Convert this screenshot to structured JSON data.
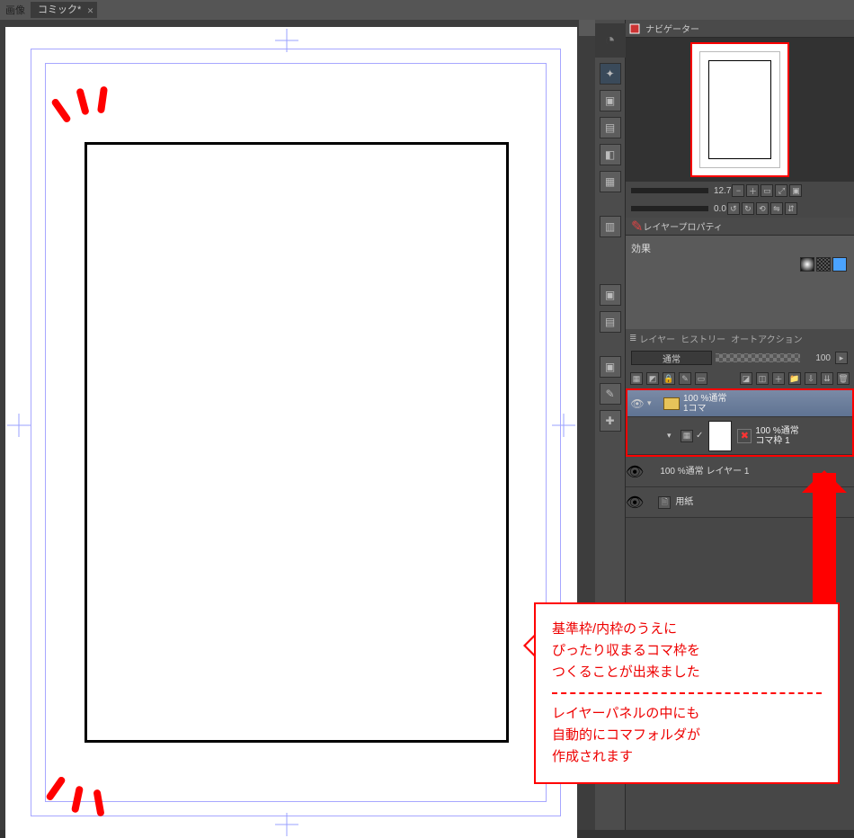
{
  "topbar": {
    "menu_label": "画像",
    "tab_title": "コミック*"
  },
  "navigator": {
    "title": "ナビゲーター",
    "zoom_value": "12.7",
    "rotate_value": "0.0"
  },
  "layer_property": {
    "title": "レイヤープロパティ",
    "section_label": "効果"
  },
  "layer_panel": {
    "tabs": {
      "layer": "レイヤー",
      "history": "ヒストリー",
      "auto_action": "オートアクション"
    },
    "blend_mode": "通常",
    "opacity": "100",
    "rows": {
      "folder": {
        "blend": "100 %通常",
        "name": "1コマ"
      },
      "frame": {
        "blend": "100 %通常",
        "name": "コマ枠 1"
      },
      "layer1": {
        "blend": "100 %通常",
        "name": "レイヤー 1"
      },
      "paper": {
        "name": "用紙"
      }
    }
  },
  "callout": {
    "line1": "基準枠/内枠のうえに",
    "line2": "ぴったり収まるコマ枠を",
    "line3": "つくることが出来ました",
    "line4": "レイヤーパネルの中にも",
    "line5": "自動的にコマフォルダが",
    "line6": "作成されます"
  },
  "icons": {
    "magnifier": "⌕",
    "reset": "↺",
    "flip": "⇋",
    "fit": "⤢",
    "eye": "👁",
    "folder": "📁"
  }
}
